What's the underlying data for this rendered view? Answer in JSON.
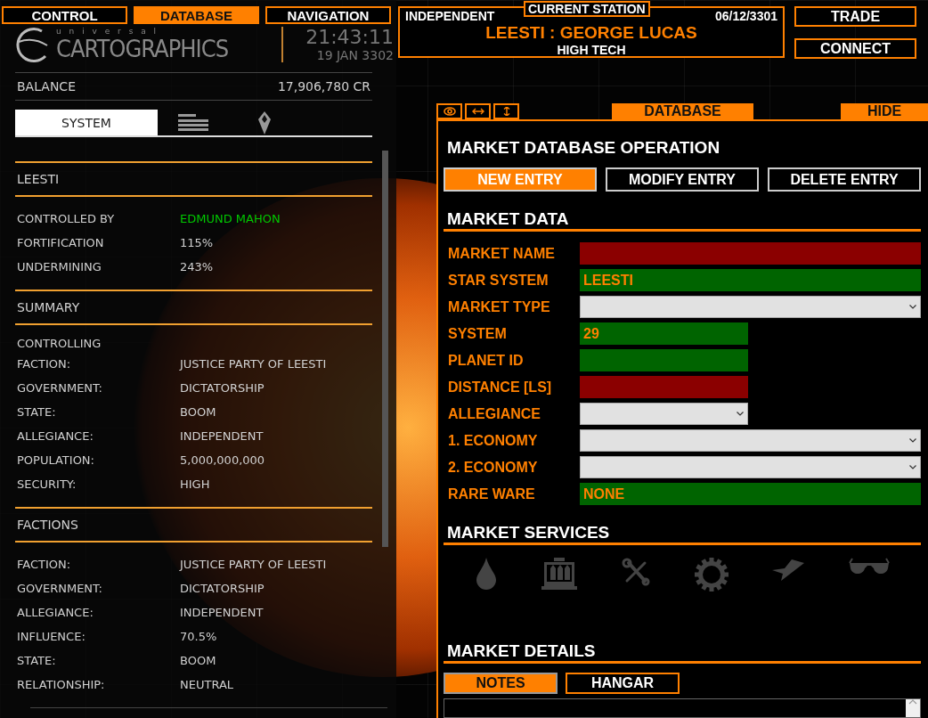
{
  "top_tabs": [
    {
      "label": "CONTROL",
      "selected": false
    },
    {
      "label": "DATABASE",
      "selected": true
    },
    {
      "label": "NAVIGATION",
      "selected": false
    }
  ],
  "logo": {
    "line1": "u n i v e r s a l",
    "line2": "CARTOGRAPHICS"
  },
  "clock": {
    "time": "21:43:11",
    "date": "19 JAN 3302"
  },
  "station": {
    "caption": "CURRENT STATION",
    "allegiance": "INDEPENDENT",
    "date": "06/12/3301",
    "name": "LEESTI : GEORGE LUCAS",
    "economy": "HIGH TECH"
  },
  "top_buttons": [
    "TRADE",
    "CONNECT"
  ],
  "balance": {
    "label": "BALANCE",
    "value": "17,906,780 CR"
  },
  "side_tabs": [
    {
      "kind": "text",
      "label": "SYSTEM",
      "selected": true
    },
    {
      "kind": "list",
      "selected": false
    },
    {
      "kind": "pin",
      "selected": false
    }
  ],
  "sections": [
    {
      "title": "LEESTI",
      "rows": [
        {
          "label": "CONTROLLED BY",
          "value": "EDMUND MAHON",
          "color": "#00c800"
        },
        {
          "label": "FORTIFICATION",
          "value": "115%"
        },
        {
          "label": "UNDERMINING",
          "value": "243%"
        }
      ]
    },
    {
      "title": "SUMMARY",
      "rows": [
        {
          "label": "CONTROLLING FACTION:",
          "value": "JUSTICE PARTY OF LEESTI"
        },
        {
          "label": "GOVERNMENT:",
          "value": "DICTATORSHIP"
        },
        {
          "label": "STATE:",
          "value": "BOOM"
        },
        {
          "label": "ALLEGIANCE:",
          "value": "INDEPENDENT"
        },
        {
          "label": "POPULATION:",
          "value": "5,000,000,000"
        },
        {
          "label": "SECURITY:",
          "value": "HIGH"
        }
      ]
    },
    {
      "title": "FACTIONS",
      "rows": [
        {
          "label": "FACTION:",
          "value": "JUSTICE PARTY OF LEESTI"
        },
        {
          "label": "GOVERNMENT:",
          "value": "DICTATORSHIP"
        },
        {
          "label": "ALLEGIANCE:",
          "value": "INDEPENDENT"
        },
        {
          "label": "INFLUENCE:",
          "value": "70.5%"
        },
        {
          "label": "STATE:",
          "value": "BOOM"
        },
        {
          "label": "RELATIONSHIP:",
          "value": "NEUTRAL"
        }
      ]
    }
  ],
  "panel_tools": [
    {
      "kind": "eye"
    },
    {
      "kind": "horizontal"
    },
    {
      "kind": "vertical"
    }
  ],
  "panel_tabs": [
    "DATABASE",
    "HIDE"
  ],
  "market": {
    "title": "MARKET DATABASE OPERATION",
    "actions": [
      {
        "label": "NEW ENTRY",
        "selected": true
      },
      {
        "label": "MODIFY ENTRY",
        "selected": false
      },
      {
        "label": "DELETE ENTRY",
        "selected": false
      }
    ],
    "data_title": "MARKET DATA",
    "fields": [
      {
        "label": "MARKET NAME",
        "kind": "input",
        "wide": true,
        "color": "#8b0000"
      },
      {
        "label": "STAR SYSTEM",
        "kind": "input",
        "wide": true,
        "color": "#006400",
        "value": "LEESTI"
      },
      {
        "label": "MARKET TYPE",
        "kind": "select",
        "wide": true
      },
      {
        "label": "SYSTEM",
        "kind": "input",
        "wide": false,
        "color": "#006400",
        "value": "29"
      },
      {
        "label": "PLANET ID",
        "kind": "input",
        "wide": false,
        "color": "#006400"
      },
      {
        "label": "DISTANCE [LS]",
        "kind": "input",
        "wide": false,
        "color": "#8b0000"
      },
      {
        "label": "ALLEGIANCE",
        "kind": "select",
        "wide": false
      },
      {
        "label": "1. ECONOMY",
        "kind": "select",
        "wide": true
      },
      {
        "label": "2. ECONOMY",
        "kind": "select",
        "wide": true
      },
      {
        "label": "RARE WARE",
        "kind": "input",
        "wide": true,
        "color": "#006400",
        "value": "NONE"
      }
    ],
    "services_title": "MARKET SERVICES",
    "services": [
      {
        "kind": "drop"
      },
      {
        "kind": "rack"
      },
      {
        "kind": "tools"
      },
      {
        "kind": "gear"
      },
      {
        "kind": "ship"
      },
      {
        "kind": "glasses"
      }
    ],
    "details_title": "MARKET DETAILS",
    "detail_tabs": [
      {
        "label": "NOTES",
        "selected": true
      },
      {
        "label": "HANGAR",
        "selected": false
      }
    ]
  }
}
